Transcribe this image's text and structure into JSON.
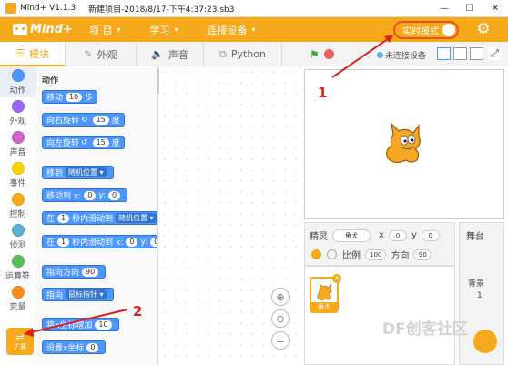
{
  "titlebar": {
    "app": "Mind+ V1.1.3",
    "project": "新建项目-2018/8/17-下午4:37:23.sb3",
    "min": "—",
    "max": "☐",
    "close": "✕"
  },
  "menubar": {
    "brand": "Mind+",
    "items": [
      {
        "label": "项 目",
        "caret": "▾"
      },
      {
        "label": "学习",
        "caret": "▾"
      },
      {
        "label": "连接设备",
        "caret": "▾"
      }
    ],
    "realtime": "实时模式",
    "accent": "#f6a91a"
  },
  "tabs": [
    {
      "label": "模块",
      "icon": "blocks-icon",
      "glyph": "☰"
    },
    {
      "label": "外观",
      "icon": "brush-icon",
      "glyph": "✎"
    },
    {
      "label": "声音",
      "icon": "speaker-icon",
      "glyph": "🔈"
    },
    {
      "label": "Python",
      "icon": "python-icon",
      "glyph": "⧉"
    }
  ],
  "stagebar": {
    "flag": "⚑",
    "connection": "未连接设备"
  },
  "categories": [
    {
      "label": "动作",
      "color": "#4c97ff"
    },
    {
      "label": "外观",
      "color": "#9966ff"
    },
    {
      "label": "声音",
      "color": "#cf63cf"
    },
    {
      "label": "事件",
      "color": "#ffd500"
    },
    {
      "label": "控制",
      "color": "#ffab19"
    },
    {
      "label": "侦测",
      "color": "#5cb1d6"
    },
    {
      "label": "运算符",
      "color": "#59c059"
    },
    {
      "label": "变量",
      "color": "#ff8c1a"
    }
  ],
  "extension": {
    "label": "扩展",
    "glyph": "⇌"
  },
  "palette": {
    "section": "动作",
    "move": {
      "a": "移动",
      "n": "10",
      "b": "步"
    },
    "turn_right": {
      "a": "向右旋转",
      "icon": "↻",
      "n": "15",
      "b": "度"
    },
    "turn_left": {
      "a": "向左旋转",
      "icon": "↺",
      "n": "15",
      "b": "度"
    },
    "goto": {
      "a": "移到",
      "dd": "随机位置 ▾"
    },
    "goto_xy": {
      "a": "移动到 x:",
      "x": "0",
      "b": "y:",
      "y": "0"
    },
    "glide": {
      "a": "在",
      "n": "1",
      "b": "秒内滑动到",
      "dd": "随机位置 ▾"
    },
    "glide_xy": {
      "a": "在",
      "n": "1",
      "b": "秒内滑动到 x:",
      "x": "0",
      "c": "y:",
      "y": "0"
    },
    "point_dir": {
      "a": "指向方向",
      "n": "90"
    },
    "point_to": {
      "a": "指向",
      "dd": "鼠标指针 ▾"
    },
    "change_x": {
      "a": "将x坐标增加",
      "n": "10"
    },
    "set_x": {
      "a": "设置x坐标",
      "n": "0"
    }
  },
  "zoom": {
    "in": "⊕",
    "out": "⊖",
    "reset": "="
  },
  "sprite": {
    "label": "精灵",
    "name": "角犬",
    "x_label": "x",
    "x": "0",
    "y_label": "y",
    "y": "0",
    "show_label": "比例",
    "size": "100",
    "dir_label": "方向",
    "direction": "90",
    "thumb_label": "角犬",
    "delete": "✕"
  },
  "stage_panel": {
    "title": "舞台",
    "backdrop_label": "背景",
    "backdrop_count": "1"
  },
  "watermark": "DF创客社区",
  "annotations": {
    "one": "1",
    "two": "2"
  }
}
